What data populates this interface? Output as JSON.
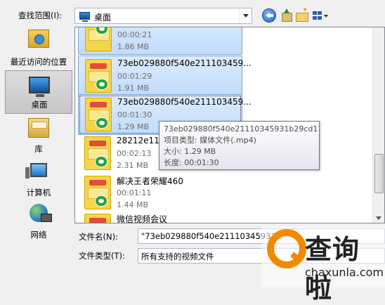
{
  "toolbar": {
    "look_in_label": "查找范围(I):",
    "look_in_value": "桌面"
  },
  "places": [
    {
      "label": "最近访问的位置",
      "icon": "recent-places-icon"
    },
    {
      "label": "桌面",
      "icon": "desktop-icon",
      "selected": true
    },
    {
      "label": "库",
      "icon": "library-icon"
    },
    {
      "label": "计算机",
      "icon": "computer-icon"
    },
    {
      "label": "网络",
      "icon": "network-icon"
    }
  ],
  "files": [
    {
      "name": "",
      "duration": "00:00:21",
      "size": "1.86 MB",
      "selected": true
    },
    {
      "name": "73eb029880f540e211103459...",
      "duration": "00:01:29",
      "size": "1.91 MB",
      "selected": true
    },
    {
      "name": "73eb029880f540e211103459...",
      "duration": "00:01:30",
      "size": "1.29 MB",
      "selected": true,
      "focused": true
    },
    {
      "name": "28212e11f1",
      "duration": "00:02:13",
      "size": "2.31 MB"
    },
    {
      "name": "解决王者荣耀460",
      "duration": "00:01:11",
      "size": "1.44 MB"
    },
    {
      "name": "微信视频会议",
      "duration": "",
      "size": ""
    }
  ],
  "tooltip": {
    "line1": "73eb029880f540e21110345931b29cd1",
    "line2": "项目类型: 媒体文件(.mp4)",
    "line3": "大小: 1.29 MB",
    "line4": "长度: 00:01:30"
  },
  "bottom": {
    "file_name_label": "文件名(N):",
    "file_name_value": "\"73eb029880f540e21110345931b",
    "file_type_label": "文件类型(T):",
    "file_type_value": "所有支持的视频文件"
  },
  "watermark": {
    "text": "查询啦",
    "url": "chaxunla.com"
  },
  "colors": {
    "selection": "#c1dcfc",
    "selection_border": "#7da2ce",
    "watermark_accent": "#f28a00"
  }
}
